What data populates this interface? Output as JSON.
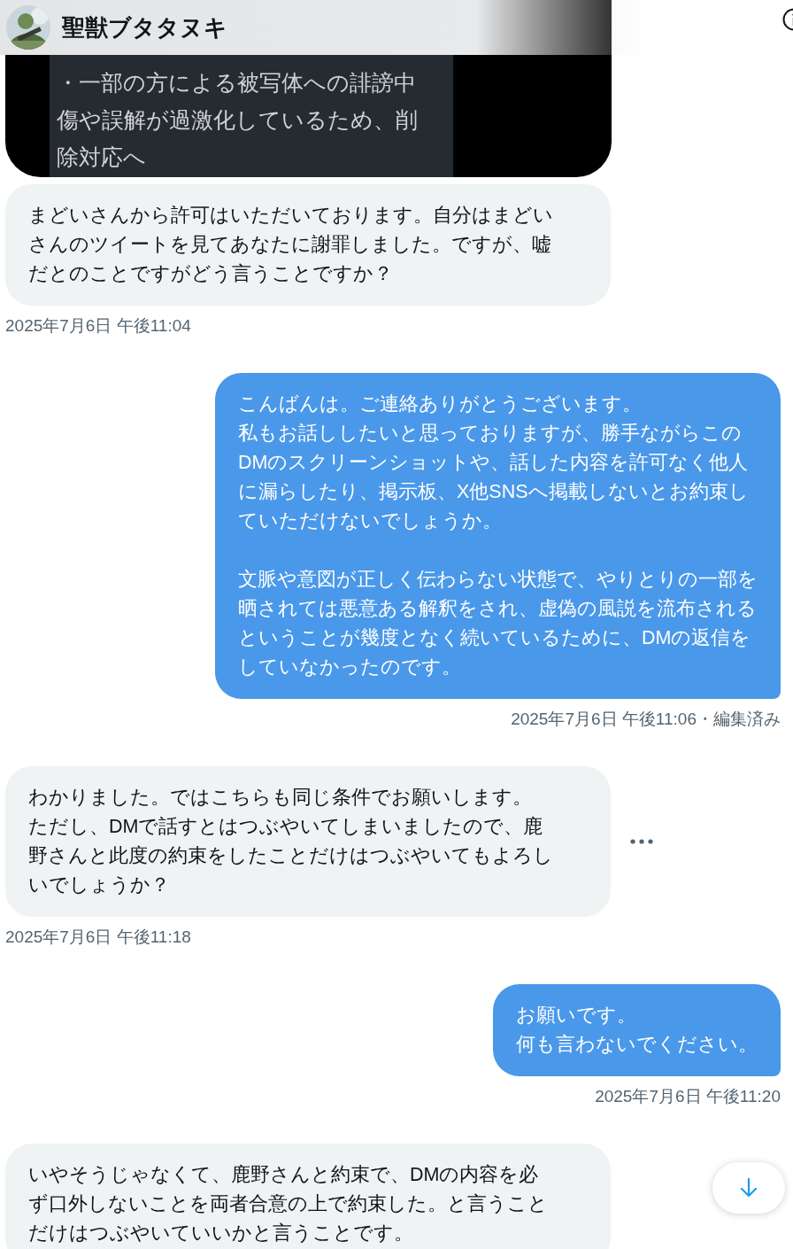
{
  "header": {
    "name": "聖獣ブタタヌキ"
  },
  "attachment": {
    "lines": [
      "・一部の方による被写体への誹謗中",
      "傷や誤解が過激化しているため、削",
      "除対応へ"
    ]
  },
  "messages": [
    {
      "kind": "received",
      "lines": [
        "まどいさんから許可はいただいております。自分はまどい",
        "さんのツイートを見てあなたに謝罪しました。ですが、嘘",
        "だとのことですがどう言うことですか？"
      ],
      "timestamp": "2025年7月6日 午後11:04",
      "actions_visible": false
    },
    {
      "kind": "sent",
      "lines": [
        "こんばんは。ご連絡ありがとうございます。",
        "私もお話ししたいと思っておりますが、勝手ながらこの",
        "DMのスクリーンショットや、話した内容を許可なく他人",
        "に漏らしたり、掲示板、X他SNSへ掲載しないとお約束し",
        "ていただけないでしょうか。"
      ],
      "lines_after_gap": [
        "文脈や意図が正しく伝わらない状態で、やりとりの一部を",
        "晒されては悪意ある解釈をされ、虚偽の風説を流布される",
        "ということが幾度となく続いているために、DMの返信を",
        "していなかったのです。"
      ],
      "timestamp": "2025年7月6日 午後11:06・編集済み",
      "actions_visible": false
    },
    {
      "kind": "received",
      "lines": [
        "わかりました。ではこちらも同じ条件でお願いします。",
        "ただし、DMで話すとはつぶやいてしまいましたので、鹿",
        "野さんと此度の約束をしたことだけはつぶやいてもよろし",
        "いでしょうか？"
      ],
      "timestamp": "2025年7月6日 午後11:18",
      "actions_visible": true
    },
    {
      "kind": "sent",
      "lines": [
        "お願いです。",
        "何も言わないでください。"
      ],
      "timestamp": "2025年7月6日 午後11:20",
      "actions_visible": false
    },
    {
      "kind": "received",
      "lines": [
        "いやそうじゃなくて、鹿野さんと約束で、DMの内容を必",
        "ず口外しないことを両者合意の上で約束した。と言うこと",
        "だけはつぶやいていいかと言うことです。"
      ],
      "actions_visible": false
    }
  ]
}
